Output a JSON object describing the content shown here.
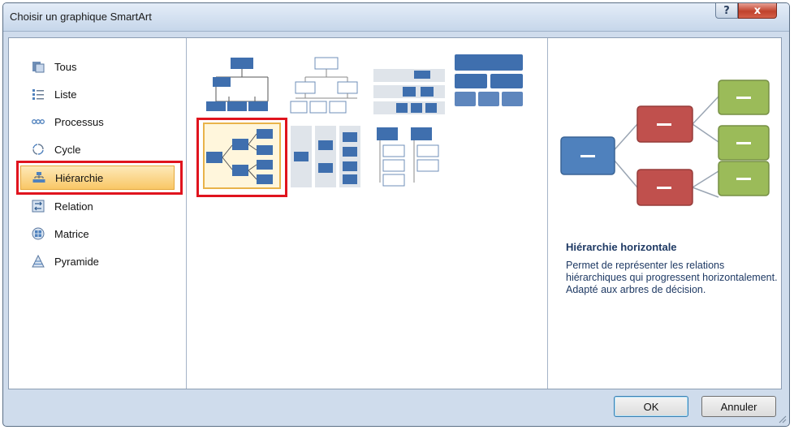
{
  "window": {
    "title": "Choisir un graphique SmartArt",
    "help_glyph": "?",
    "close_glyph": "x"
  },
  "categories": [
    {
      "label": "Tous",
      "icon": "all-icon"
    },
    {
      "label": "Liste",
      "icon": "list-icon"
    },
    {
      "label": "Processus",
      "icon": "process-icon"
    },
    {
      "label": "Cycle",
      "icon": "cycle-icon"
    },
    {
      "label": "Hiérarchie",
      "icon": "hierarchy-icon",
      "selected": true
    },
    {
      "label": "Relation",
      "icon": "relation-icon"
    },
    {
      "label": "Matrice",
      "icon": "matrix-icon"
    },
    {
      "label": "Pyramide",
      "icon": "pyramid-icon"
    }
  ],
  "gallery": {
    "selected_index": 4
  },
  "preview": {
    "title": "Hiérarchie horizontale",
    "description": "Permet de représenter les relations hiérarchiques qui progressent horizontalement. Adapté aux arbres de décision."
  },
  "buttons": {
    "ok": "OK",
    "cancel": "Annuler"
  },
  "colors": {
    "node_blue": "#4f81bd",
    "node_red": "#c0504d",
    "node_green": "#9bbb59",
    "selection_orange": "#f9c766",
    "annotation_red": "#e0141e"
  }
}
